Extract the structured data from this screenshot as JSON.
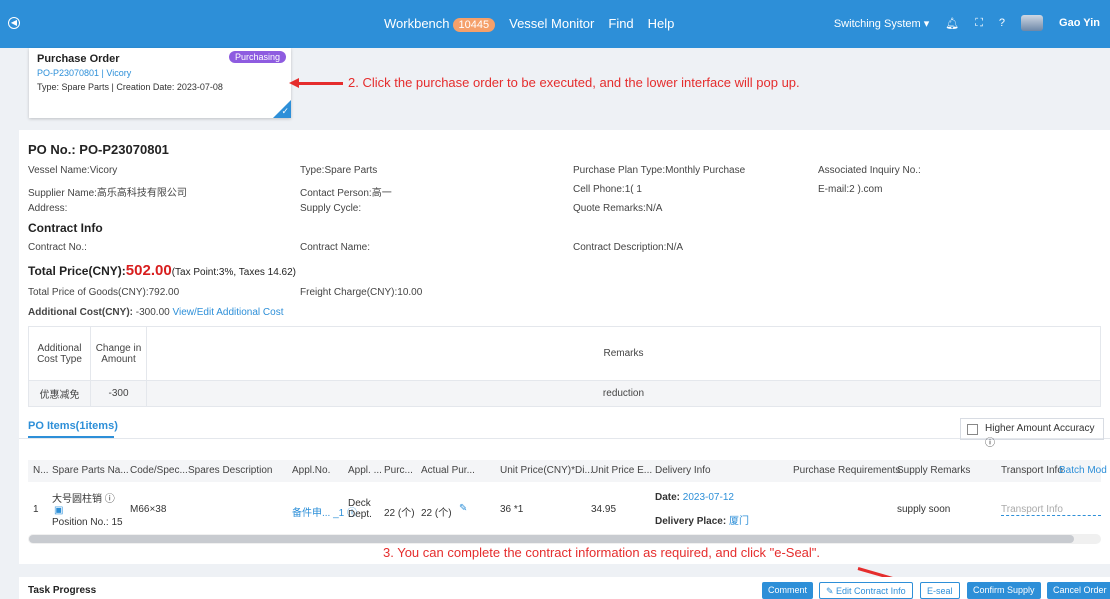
{
  "topbar": {
    "nav": [
      {
        "label": "Workbench",
        "badge": "10445"
      },
      {
        "label": "Vessel Monitor"
      },
      {
        "label": "Find"
      },
      {
        "label": "Help"
      }
    ],
    "system_switch": "Switching System ▾",
    "user": "Gao Yin"
  },
  "card": {
    "title": "Purchase Order",
    "status": "Purchasing",
    "link": "PO-P23070801 | Vicory",
    "meta": "Type: Spare Parts | Creation Date: 2023-07-08"
  },
  "annotations": {
    "step2": "2. Click the purchase order to be executed, and the lower interface will pop up.",
    "step3": "3. You can complete the contract information as required, and click \"e-Seal\"."
  },
  "po": {
    "number": "PO No.: PO-P23070801",
    "vessel": "Vessel Name:Vicory",
    "type": "Type:Spare Parts",
    "plan_type": "Purchase Plan Type:Monthly Purchase",
    "inquiry": "Associated Inquiry No.:",
    "supplier": "Supplier Name:高乐高科技有限公司",
    "contact": "Contact Person:高一",
    "cell": "Cell Phone:1(  1",
    "email": "E-mail:2  ).com",
    "address": "Address:",
    "supply_cycle": "Supply Cycle:",
    "quote_remarks": "Quote Remarks:N/A"
  },
  "contract": {
    "title": "Contract Info",
    "no": "Contract No.:",
    "name": "Contract Name:",
    "description": "Contract Description:N/A"
  },
  "totals": {
    "label": "Total Price(CNY):",
    "value": "502.00",
    "tax": "(Tax Point:3%, Taxes 14.62)",
    "goods": "Total Price of Goods(CNY):792.00",
    "freight": "Freight Charge(CNY):10.00",
    "additional_label": "Additional Cost(CNY):",
    "additional_value": "-300.00",
    "additional_link": "View/Edit Additional Cost"
  },
  "cost_table": {
    "headers": [
      "Additional Cost Type",
      "Change in Amount",
      "Remarks"
    ],
    "rows": [
      [
        "优惠减免",
        "-300",
        "reduction"
      ]
    ]
  },
  "items": {
    "tab": "PO Items(1items)",
    "accuracy": "Higher Amount Accuracy ⓘ",
    "headers": [
      "N...",
      "Spare Parts Na...",
      "Code/Spec...",
      "Spares Description",
      "Appl.No.",
      "Appl. ...",
      "Purc...",
      "Actual Pur...",
      "Unit Price(CNY)*Di...",
      "Unit Price E...",
      "Delivery Info",
      "Purchase Requirements",
      "Supply Remarks",
      "Transport Info",
      "Batch Mod"
    ],
    "row": {
      "no": "1",
      "name": "大号圆柱销 ⓘ",
      "position": "Position No.: 15",
      "code": "M66×38",
      "appl_no": "备件申... _1 ⓘ",
      "appl_dept": "Deck Dept.",
      "purchase_qty": "22 (个)",
      "actual_qty": "22 (个)",
      "unit_price": "36 *1",
      "unit_price_e": "34.95",
      "date_label": "Date:",
      "date": "2023-07-12",
      "place_label": "Delivery Place:",
      "place": "厦门",
      "supply_remarks": "supply soon",
      "transport_placeholder": "Transport Info"
    }
  },
  "bottom": {
    "task_progress": "Task Progress",
    "buttons": [
      "Comment",
      "Edit Contract Info",
      "E-seal",
      "Confirm Supply",
      "Cancel Order"
    ]
  },
  "colors": {
    "primary": "#2d8fd8",
    "annotation": "#e52d2d",
    "status": "#8e5ce0",
    "price": "#d81e1e"
  }
}
